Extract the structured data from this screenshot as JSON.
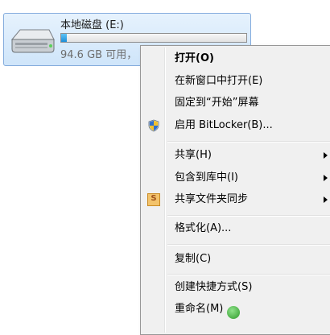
{
  "drive": {
    "name": "本地磁盘 (E:)",
    "free_space": "94.6 GB 可用，",
    "usage_fraction": 0.03,
    "icon": "hard-drive-icon"
  },
  "context_menu": {
    "open": "打开(O)",
    "open_new_window": "在新窗口中打开(E)",
    "pin_to_start": "固定到“开始”屏幕",
    "enable_bitlocker": "启用 BitLocker(B)...",
    "share": "共享(H)",
    "include_in_library": "包含到库中(I)",
    "sync_shared_folder": "共享文件夹同步",
    "format": "格式化(A)...",
    "copy": "复制(C)",
    "create_shortcut": "创建快捷方式(S)",
    "rename": "重命名(M)"
  },
  "colors": {
    "menu_background": "#f0f0f0",
    "selection_tile": "#cfe5fa",
    "usage_bar": "#1d8ed8"
  }
}
